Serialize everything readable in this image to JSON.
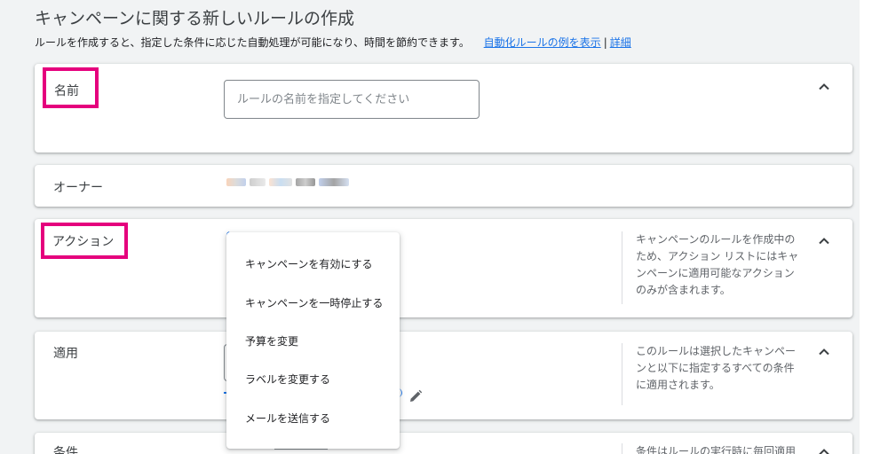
{
  "page": {
    "title": "キャンペーンに関する新しいルールの作成",
    "subtitle": "ルールを作成すると、指定した条件に応じた自動処理が可能になり、時間を節約できます。",
    "example_link": "自動化ルールの例を表示",
    "separator": "|",
    "details_link": "詳細"
  },
  "name_section": {
    "label": "名前",
    "input_placeholder": "ルールの名前を指定してください",
    "input_value": ""
  },
  "owner_section": {
    "label": "オーナー"
  },
  "action_section": {
    "label": "アクション",
    "note": "キャンペーンのルールを作成中のため、アクション リストにはキャンペーンに適用可能なアクションのみが含まれます。"
  },
  "apply_section": {
    "label": "適用",
    "note": "このルールは選択したキャンペーンと以下に指定するすべての条件に適用されます。"
  },
  "conditions_section": {
    "label": "条件",
    "note": "条件はルールの実行時に毎回適用"
  },
  "action_menu": {
    "items": [
      "キャンペーンを有効にする",
      "キャンペーンを一時停止する",
      "予算を変更",
      "ラベルを変更する",
      "メールを送信する"
    ]
  },
  "icons": {
    "collapse": "chevron-up-icon",
    "edit": "pencil-icon"
  },
  "colors": {
    "highlight": "#e5007d",
    "link": "#1a73e8"
  }
}
